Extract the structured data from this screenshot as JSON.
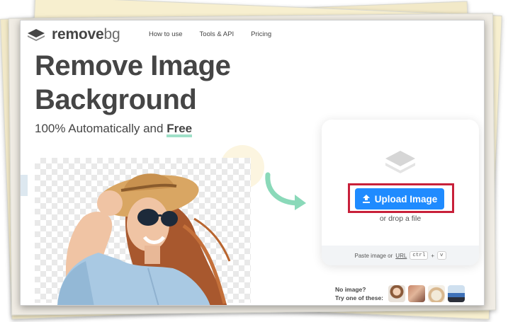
{
  "brand": {
    "name_main": "remove",
    "name_suffix": "bg"
  },
  "nav": {
    "links": [
      "How to use",
      "Tools & API",
      "Pricing"
    ]
  },
  "hero": {
    "headline_line1": "Remove Image",
    "headline_line2": "Background",
    "subline_prefix": "100% Automatically and",
    "subline_emphasis": "Free"
  },
  "upload": {
    "button_label": "Upload Image",
    "drop_text": "or drop a file",
    "paste_prefix": "Paste image or",
    "paste_url": "URL",
    "shortcut_key1": "ctrl",
    "shortcut_plus": "+",
    "shortcut_key2": "v"
  },
  "samples": {
    "line1": "No image?",
    "line2": "Try one of these:"
  },
  "colors": {
    "accent_blue": "#1f8bff",
    "highlight_red": "#c8203a",
    "text_dark": "#454545",
    "arrow_green": "#8ad9b9"
  }
}
